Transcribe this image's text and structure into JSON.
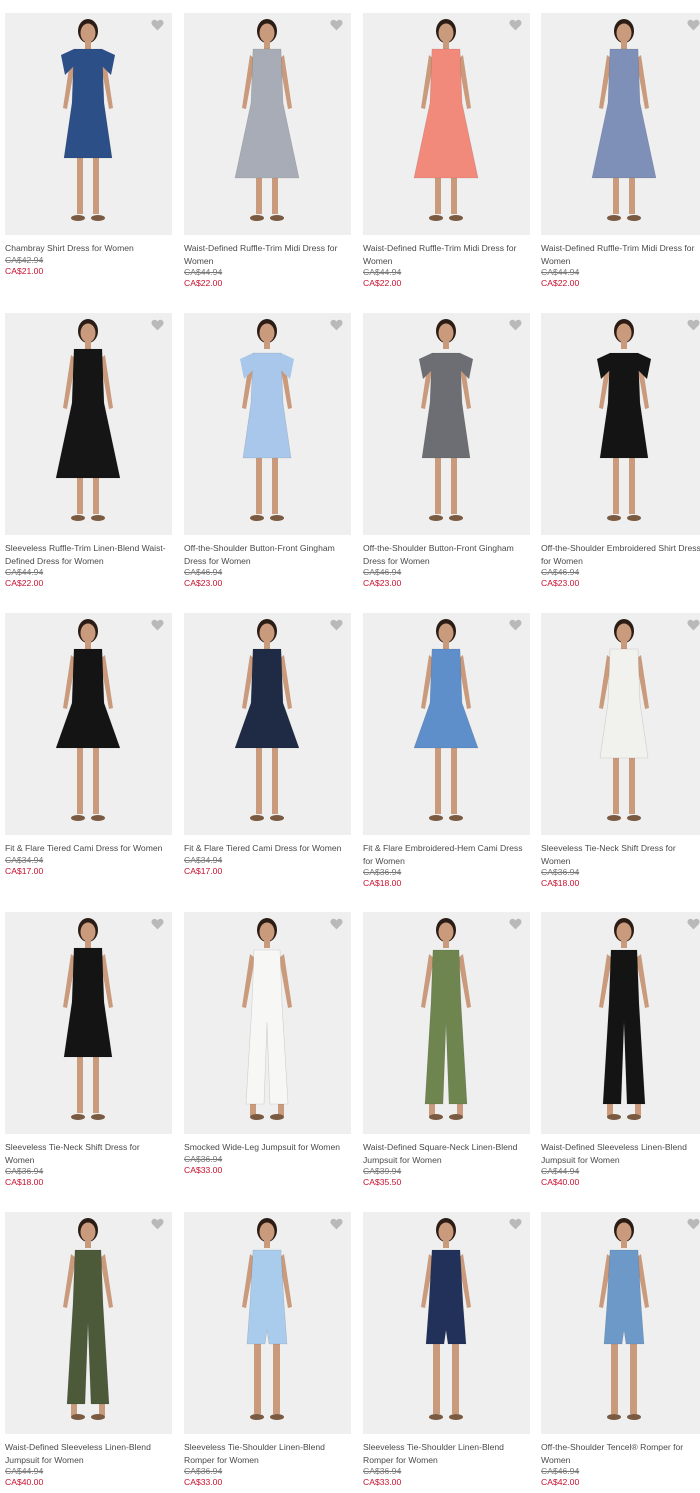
{
  "accent_sale_color": "#c8102e",
  "favorite_icon": "heart-icon",
  "products": [
    {
      "name": "Chambray Shirt Dress for Women",
      "was": "CA$42.94",
      "now": "CA$21.00",
      "dress_color": "#2c4f88",
      "style": "shirt"
    },
    {
      "name": "Waist-Defined Ruffle-Trim Midi Dress for Women",
      "was": "CA$44.94",
      "now": "CA$22.00",
      "dress_color": "#a8acb6",
      "style": "midi"
    },
    {
      "name": "Waist-Defined Ruffle-Trim Midi Dress for Women",
      "was": "CA$44.94",
      "now": "CA$22.00",
      "dress_color": "#f28a7c",
      "style": "midi"
    },
    {
      "name": "Waist-Defined Ruffle-Trim Midi Dress for Women",
      "was": "CA$44.94",
      "now": "CA$22.00",
      "dress_color": "#7e8fb8",
      "style": "midi"
    },
    {
      "name": "Sleeveless Ruffle-Trim Linen-Blend Waist-Defined Dress for Women",
      "was": "CA$44.94",
      "now": "CA$22.00",
      "dress_color": "#151515",
      "style": "midi"
    },
    {
      "name": "Off-the-Shoulder Button-Front Gingham Dress for Women",
      "was": "CA$46.94",
      "now": "CA$23.00",
      "dress_color": "#a9c7ea",
      "style": "offshoulder"
    },
    {
      "name": "Off-the-Shoulder Button-Front Gingham Dress for Women",
      "was": "CA$46.94",
      "now": "CA$23.00",
      "dress_color": "#6d6e74",
      "style": "offshoulder"
    },
    {
      "name": "Off-the-Shoulder Embroidered Shirt Dress for Women",
      "was": "CA$46.94",
      "now": "CA$23.00",
      "dress_color": "#141414",
      "style": "offshoulder"
    },
    {
      "name": "Fit & Flare Tiered Cami Dress for Women",
      "was": "CA$34.94",
      "now": "CA$17.00",
      "dress_color": "#141414",
      "style": "cami"
    },
    {
      "name": "Fit & Flare Tiered Cami Dress for Women",
      "was": "CA$34.94",
      "now": "CA$17.00",
      "dress_color": "#1f2b45",
      "style": "cami"
    },
    {
      "name": "Fit & Flare Embroidered-Hem Cami Dress for Women",
      "was": "CA$36.94",
      "now": "CA$18.00",
      "dress_color": "#5f8fcb",
      "style": "cami"
    },
    {
      "name": "Sleeveless Tie-Neck Shift Dress for Women",
      "was": "CA$36.94",
      "now": "CA$18.00",
      "dress_color": "#f1f1ee",
      "style": "shift"
    },
    {
      "name": "Sleeveless Tie-Neck Shift Dress for Women",
      "was": "CA$36.94",
      "now": "CA$18.00",
      "dress_color": "#141414",
      "style": "shift"
    },
    {
      "name": "Smocked Wide-Leg Jumpsuit for Women",
      "was": "CA$36.94",
      "now": "CA$33.00",
      "dress_color": "#f7f7f5",
      "style": "jumpsuit"
    },
    {
      "name": "Waist-Defined Square-Neck Linen-Blend Jumpsuit for Women",
      "was": "CA$39.94",
      "now": "CA$35.50",
      "dress_color": "#6e8550",
      "style": "jumpsuit"
    },
    {
      "name": "Waist-Defined Sleeveless Linen-Blend Jumpsuit for Women",
      "was": "CA$44.94",
      "now": "CA$40.00",
      "dress_color": "#141414",
      "style": "jumpsuit"
    },
    {
      "name": "Waist-Defined Sleeveless Linen-Blend Jumpsuit for Women",
      "was": "CA$44.94",
      "now": "CA$40.00",
      "dress_color": "#4c5a3a",
      "style": "jumpsuit"
    },
    {
      "name": "Sleeveless Tie-Shoulder Linen-Blend Romper for Women",
      "was": "CA$36.94",
      "now": "CA$33.00",
      "dress_color": "#a9cbec",
      "style": "romper"
    },
    {
      "name": "Sleeveless Tie-Shoulder Linen-Blend Romper for Women",
      "was": "CA$36.94",
      "now": "CA$33.00",
      "dress_color": "#22315a",
      "style": "romper"
    },
    {
      "name": "Off-the-Shoulder Tencel® Romper for Women",
      "was": "CA$46.94",
      "now": "CA$42.00",
      "dress_color": "#6d99c9",
      "style": "romper"
    }
  ]
}
